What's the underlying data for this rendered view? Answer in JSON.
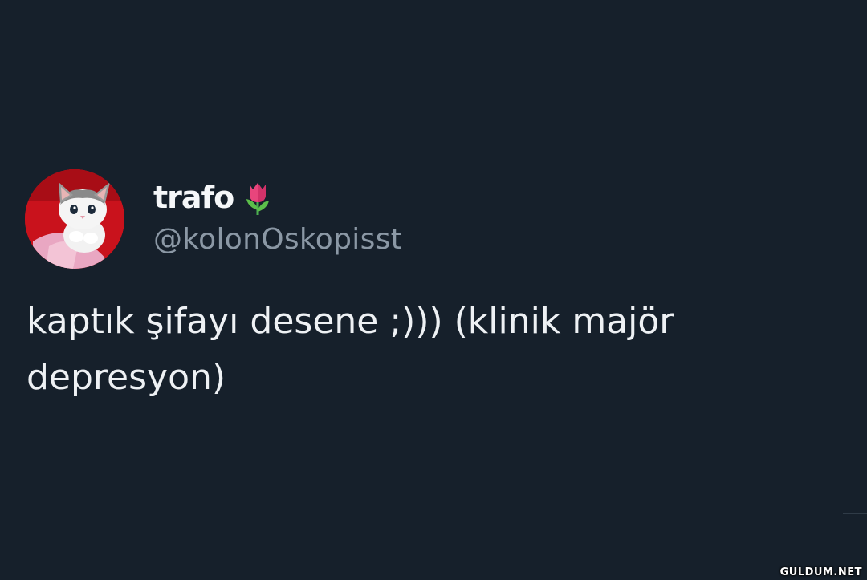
{
  "tweet": {
    "author": {
      "display_name": "trafo",
      "name_emoji": "tulip-icon",
      "username": "@kolonOskopisst",
      "avatar": "kitten-avatar"
    },
    "text": "kaptık şifayı desene ;))) (klinik majör depresyon)"
  },
  "watermark": "GULDUM.NET",
  "colors": {
    "background": "#16202b",
    "display_name": "#f5f7f9",
    "username": "#8b98a5",
    "text": "#eef1f4"
  }
}
